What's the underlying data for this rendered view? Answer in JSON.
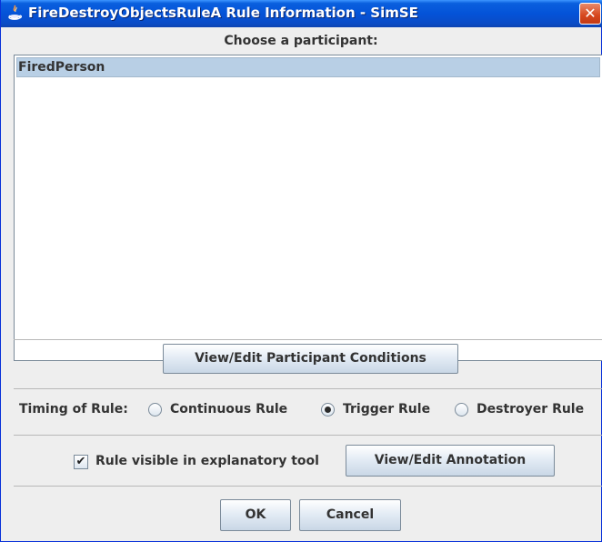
{
  "window": {
    "title": "FireDestroyObjectsRuleA Rule Information - SimSE",
    "close_glyph": "✕"
  },
  "participants": {
    "prompt": "Choose a participant:",
    "items": [
      {
        "label": "FiredPerson",
        "selected": true
      }
    ]
  },
  "buttons": {
    "view_edit_conditions": "View/Edit Participant Conditions",
    "view_edit_annotation": "View/Edit Annotation",
    "ok": "OK",
    "cancel": "Cancel"
  },
  "timing": {
    "label": "Timing of Rule:",
    "options": [
      {
        "label": "Continuous Rule",
        "selected": false
      },
      {
        "label": "Trigger Rule",
        "selected": true
      },
      {
        "label": "Destroyer Rule",
        "selected": false
      }
    ]
  },
  "visibility": {
    "checkbox_label": "Rule visible in explanatory tool",
    "checked": true
  },
  "colors": {
    "titlebar": "#0453d8",
    "selection": "#b8cfe5",
    "close_button": "#d6461d"
  },
  "icons": {
    "app": "java-icon",
    "close": "close-icon"
  }
}
